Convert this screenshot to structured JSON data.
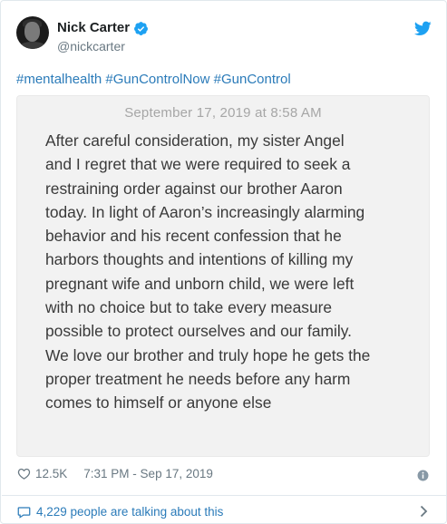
{
  "author": {
    "display_name": "Nick Carter",
    "handle": "@nickcarter",
    "verified": true
  },
  "hashtags": [
    "#mentalhealth",
    "#GunControlNow",
    "#GunControl"
  ],
  "note": {
    "date": "September 17, 2019 at 8:58 AM",
    "text": "After careful consideration, my sister Angel\nand I regret that we were required to seek a\nrestraining order against our brother Aaron\ntoday.  In light of Aaron’s increasingly alarming\nbehavior and his recent confession that he\nharbors thoughts and intentions of killing my\npregnant wife and unborn child, we were left\nwith no choice but to take every measure\npossible to protect ourselves and our family.\nWe love our brother and truly hope he gets the\nproper treatment he needs before any harm\ncomes to himself or anyone else"
  },
  "meta": {
    "likes": "12.5K",
    "timestamp": "7:31 PM - Sep 17, 2019"
  },
  "footer": {
    "talking": "4,229 people are talking about this"
  },
  "icons": {
    "verified": "verified-badge-icon",
    "platform": "twitter-bird-icon",
    "like": "heart-icon",
    "info": "info-icon",
    "conversation": "speech-bubble-icon",
    "more": "chevron-right-icon"
  },
  "colors": {
    "link": "#2b7bb9",
    "secondary_text": "#697882",
    "verified": "#1da1f2"
  }
}
